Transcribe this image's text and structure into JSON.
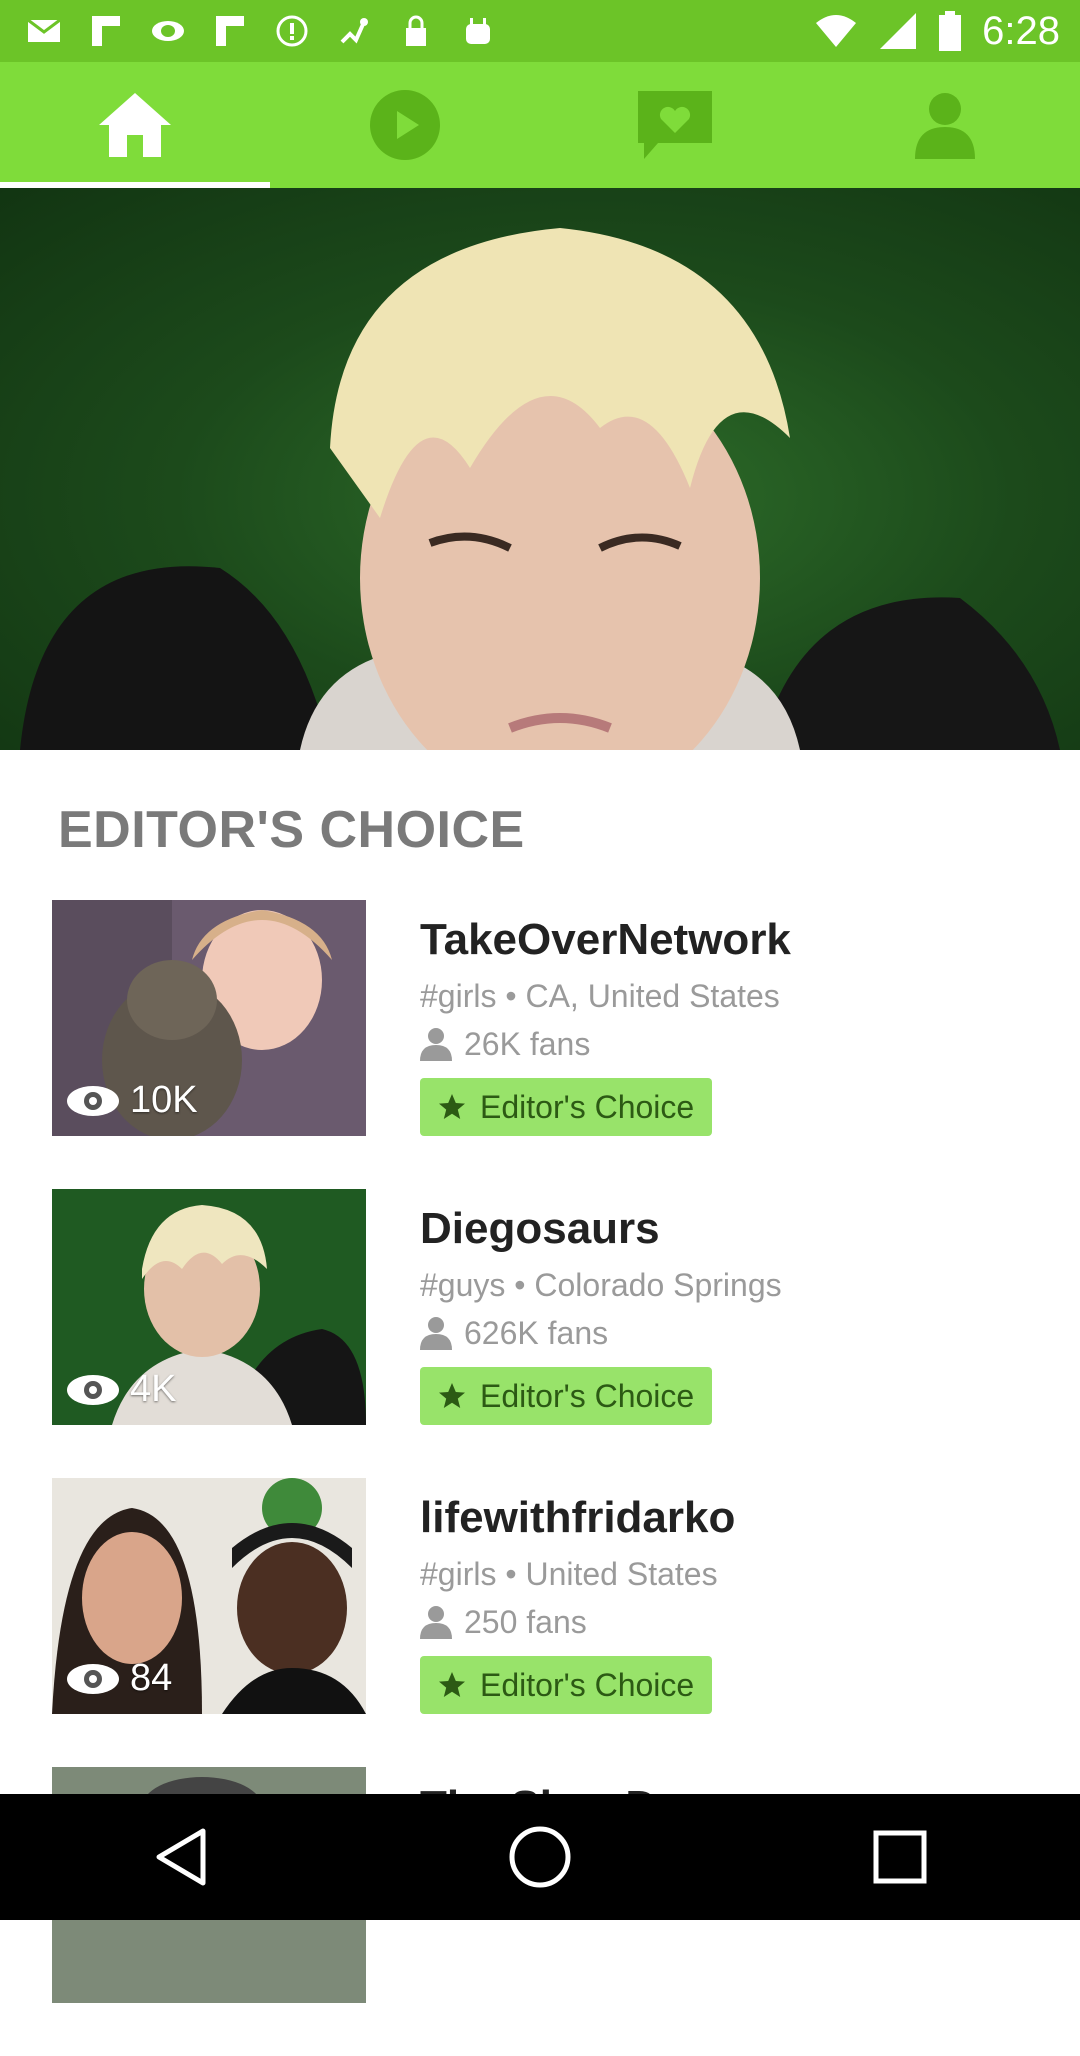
{
  "status_bar": {
    "time": "6:28",
    "left_icons": [
      "mail-icon",
      "flipboard-icon",
      "eye-vr-icon",
      "flipboard-icon",
      "alert-icon",
      "satellite-icon",
      "lock-icon",
      "android-icon"
    ],
    "right_icons": [
      "wifi-icon",
      "signal-icon",
      "battery-icon"
    ]
  },
  "tabs": [
    {
      "icon": "home-icon",
      "active": true
    },
    {
      "icon": "play-icon",
      "active": false
    },
    {
      "icon": "heart-message-icon",
      "active": false
    },
    {
      "icon": "profile-icon",
      "active": false
    }
  ],
  "section": {
    "title": "EDITOR'S CHOICE"
  },
  "items": [
    {
      "name": "TakeOverNetwork",
      "meta": "#girls • CA, United States",
      "fans": "26K fans",
      "views": "10K",
      "badge": "Editor's Choice"
    },
    {
      "name": "Diegosaurs",
      "meta": "#guys • Colorado Springs",
      "fans": "626K fans",
      "views": "4K",
      "badge": "Editor's Choice"
    },
    {
      "name": "lifewithfridarko",
      "meta": "#girls • United States",
      "fans": "250 fans",
      "views": "84",
      "badge": "Editor's Choice"
    },
    {
      "name": "The Slow D...",
      "meta": "",
      "fans": "",
      "views": "",
      "badge": ""
    }
  ],
  "nav": [
    "back-icon",
    "home-circle-icon",
    "recents-icon"
  ],
  "colors": {
    "status_bar": "#6cc428",
    "tab_bar": "#7fdc3a",
    "tab_icon": "#5bb31a",
    "badge_bg": "#98e36a",
    "badge_text": "#2c5a14"
  }
}
